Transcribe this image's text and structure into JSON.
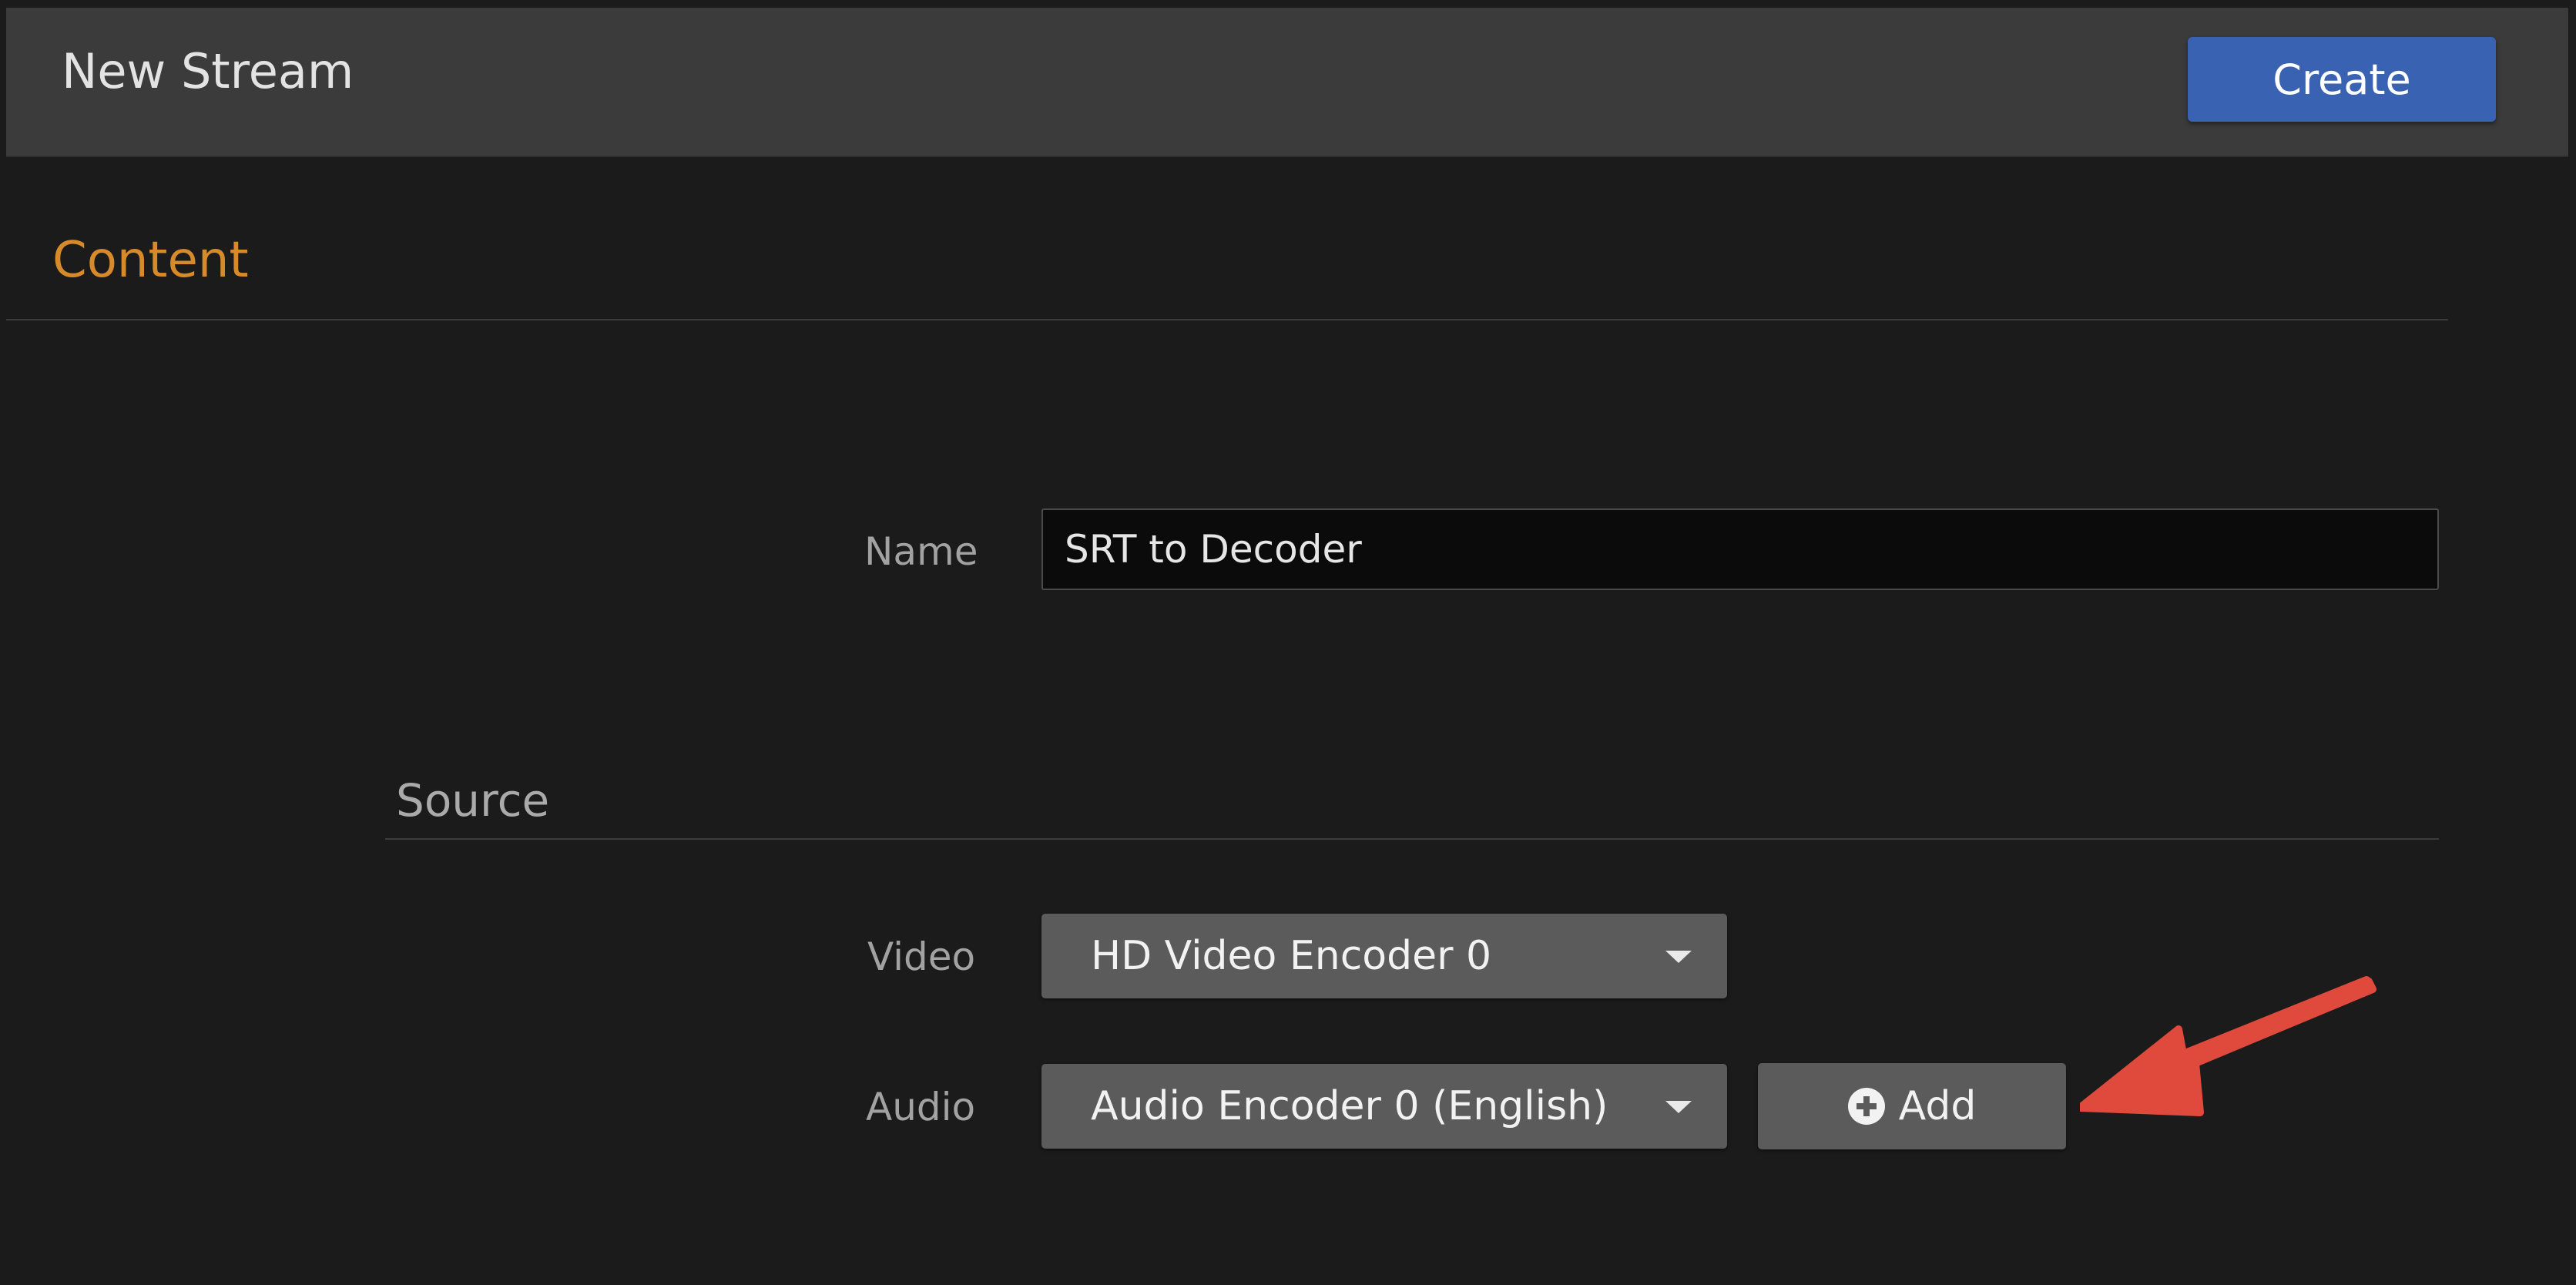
{
  "header": {
    "title": "New Stream",
    "create_label": "Create"
  },
  "content_section": {
    "title": "Content"
  },
  "name_field": {
    "label": "Name",
    "value": "SRT to Decoder"
  },
  "source_section": {
    "title": "Source",
    "video": {
      "label": "Video",
      "selected": "HD Video Encoder 0"
    },
    "audio": {
      "label": "Audio",
      "selected": "Audio Encoder 0 (English)",
      "add_label": "Add"
    }
  },
  "icons": {
    "add": "plus-circle-icon",
    "dropdown": "chevron-down-icon",
    "annotation": "arrow-icon"
  },
  "colors": {
    "accent_primary": "#3a62b3",
    "section_title": "#d68a2a",
    "annotation_arrow": "#e04a3c",
    "background": "#1b1b1b",
    "header_background": "#3b3b3b"
  }
}
